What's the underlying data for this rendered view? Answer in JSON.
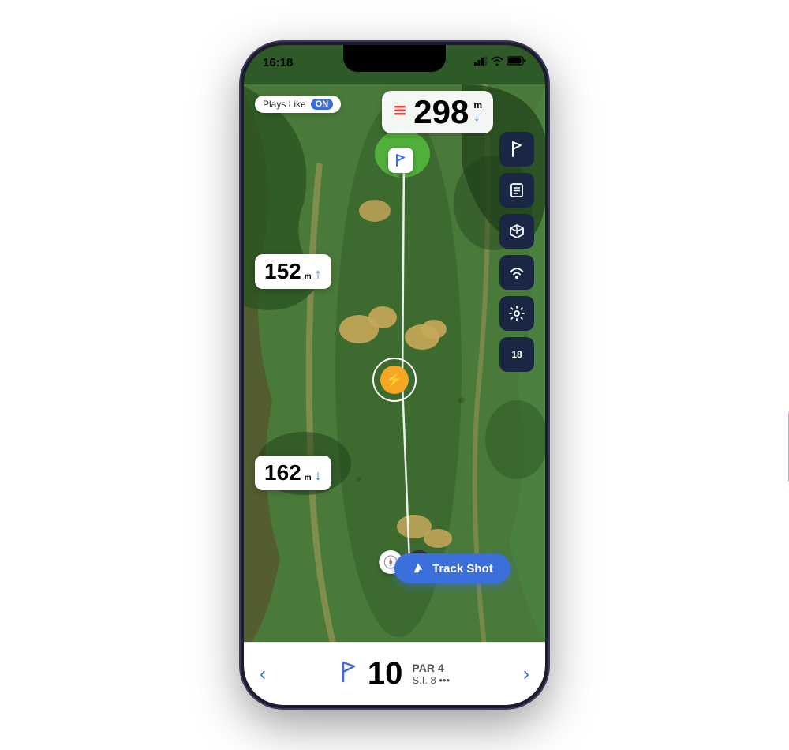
{
  "status_bar": {
    "time": "16:18",
    "signal_bars": "▂▄▆",
    "wifi": "wifi",
    "battery": "battery"
  },
  "map": {
    "plays_like_label": "Plays Like",
    "plays_like_status": "ON",
    "distance_value": "298",
    "distance_unit": "m",
    "distance_to_front": "152",
    "distance_to_front_unit": "m",
    "distance_to_back": "162",
    "distance_to_back_unit": "m"
  },
  "toolbar": {
    "btn1": "flag",
    "btn2": "scorecard",
    "btn3": "3d",
    "btn4": "wifi",
    "btn5": "settings",
    "btn6": "18"
  },
  "track_shot_button": {
    "label": "Track Shot",
    "icon": "⛳"
  },
  "bottom_nav": {
    "prev_arrow": "‹",
    "next_arrow": "›",
    "hole_number": "10",
    "par_label": "PAR 4",
    "si_label": "S.I. 8",
    "dots": "•••"
  }
}
